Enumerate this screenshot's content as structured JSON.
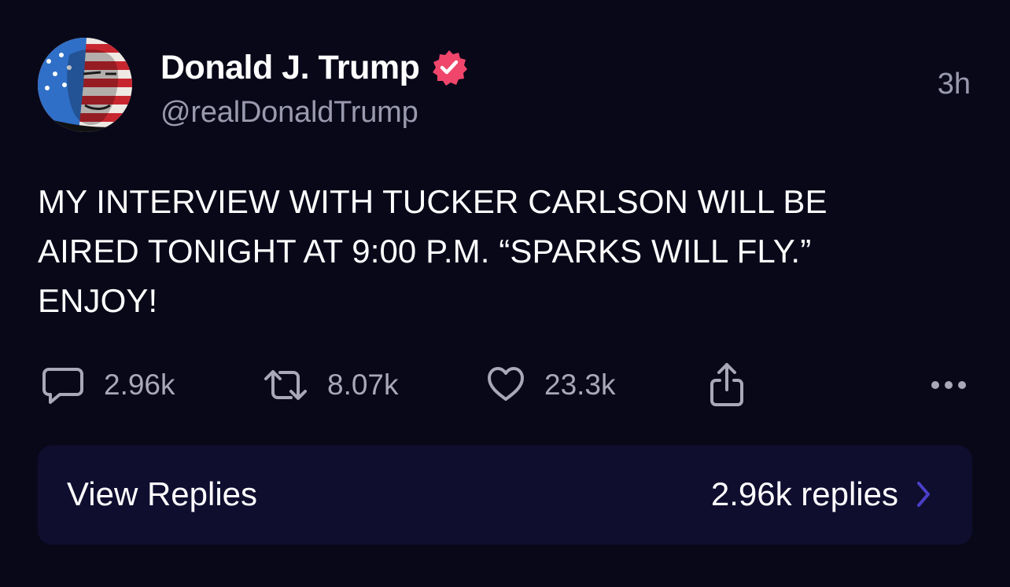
{
  "author": {
    "display_name": "Donald J. Trump",
    "handle": "@realDonaldTrump",
    "verified": true,
    "avatar_icon": "flag-portrait-avatar"
  },
  "post": {
    "time_ago": "3h",
    "text": "MY INTERVIEW WITH TUCKER CARLSON WILL BE\nAIRED TONIGHT AT 9:00 P.M. “SPARKS WILL FLY.”\nENJOY!"
  },
  "actions": {
    "replies_count": "2.96k",
    "reposts_count": "8.07k",
    "likes_count": "23.3k",
    "reply_icon": "comment-icon",
    "repost_icon": "repost-icon",
    "like_icon": "heart-icon",
    "share_icon": "share-icon",
    "more_icon": "more-dots-icon"
  },
  "replies_card": {
    "label": "View Replies",
    "count_text": "2.96k replies"
  },
  "colors": {
    "background": "#090819",
    "card": "#100e2f",
    "muted_text": "#9a9aae",
    "verified_badge": "#f0466b",
    "chevron": "#4b3fc9"
  }
}
